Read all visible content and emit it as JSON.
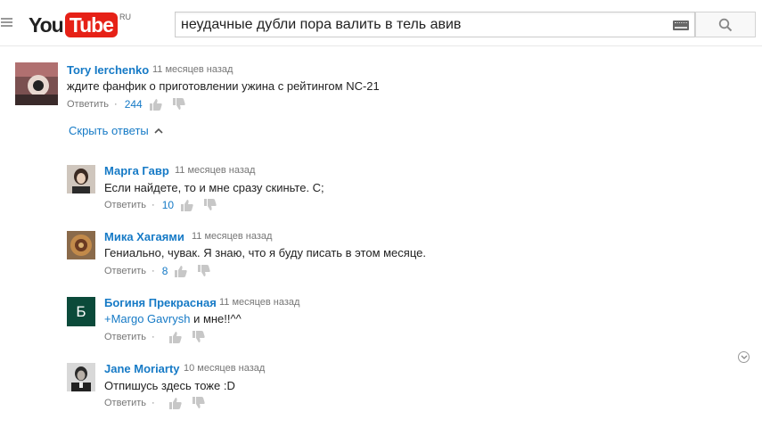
{
  "header": {
    "logo_you": "You",
    "logo_tube": "Tube",
    "logo_region": "RU",
    "search_value": "неудачные дубли пора валить в тель авив"
  },
  "thread": {
    "author": "Tory Ierchenko",
    "time": "11 месяцев назад",
    "text": "ждите фанфик о приготовлении ужина с рейтингом NC-21",
    "reply_label": "Ответить",
    "likes": "244"
  },
  "hide_replies_label": "Скрыть ответы",
  "replies": [
    {
      "author": "Марга Гавр",
      "time": "11 месяцев назад",
      "text": "Если найдете, то и мне сразу скиньте. С;",
      "reply_label": "Ответить",
      "likes": "10"
    },
    {
      "author": "Мика Хагаями",
      "time": "11 месяцев назад",
      "text": "Гениально, чувак. Я знаю, что я буду писать в этом месяце.",
      "reply_label": "Ответить",
      "likes": "8"
    },
    {
      "author": "Богиня Прекрасная",
      "time": "11 месяцев назад",
      "mention": "+Margo Gavrysh",
      "text": " и мне!!^^",
      "reply_label": "Ответить",
      "likes": "",
      "avatar_letter": "Б"
    },
    {
      "author": "Jane Moriarty",
      "time": "10 месяцев назад",
      "text": "Отпишусь здесь тоже :D",
      "reply_label": "Ответить",
      "likes": ""
    }
  ],
  "colors": {
    "link": "#167ac6",
    "muted": "#767676",
    "brand_red": "#e62117"
  }
}
